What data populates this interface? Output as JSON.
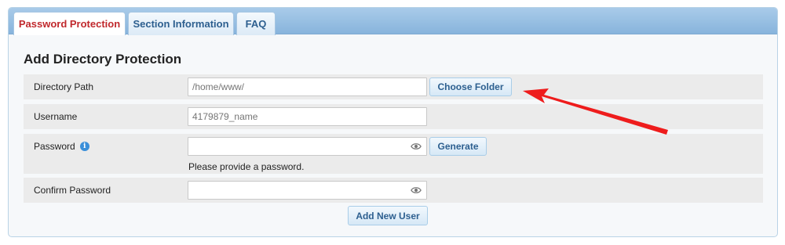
{
  "tabs": [
    {
      "label": "Password Protection",
      "active": true
    },
    {
      "label": "Section Information",
      "active": false
    },
    {
      "label": "FAQ",
      "active": false
    }
  ],
  "form": {
    "title": "Add Directory Protection",
    "directory_path": {
      "label": "Directory Path",
      "placeholder": "/home/www/",
      "button": "Choose Folder"
    },
    "username": {
      "label": "Username",
      "placeholder": "4179879_name"
    },
    "password": {
      "label": "Password",
      "value": "",
      "button": "Generate",
      "helper": "Please provide a password."
    },
    "confirm_password": {
      "label": "Confirm Password",
      "value": ""
    },
    "submit": "Add New User"
  },
  "icons": {
    "info": "info-icon",
    "eye": "eye-icon",
    "annotation": "red-arrow"
  },
  "colors": {
    "active_tab_text": "#c0282c",
    "link_blue": "#2d5f8f",
    "arrow": "#ee1c1c",
    "info_blue": "#3a8fd9"
  }
}
